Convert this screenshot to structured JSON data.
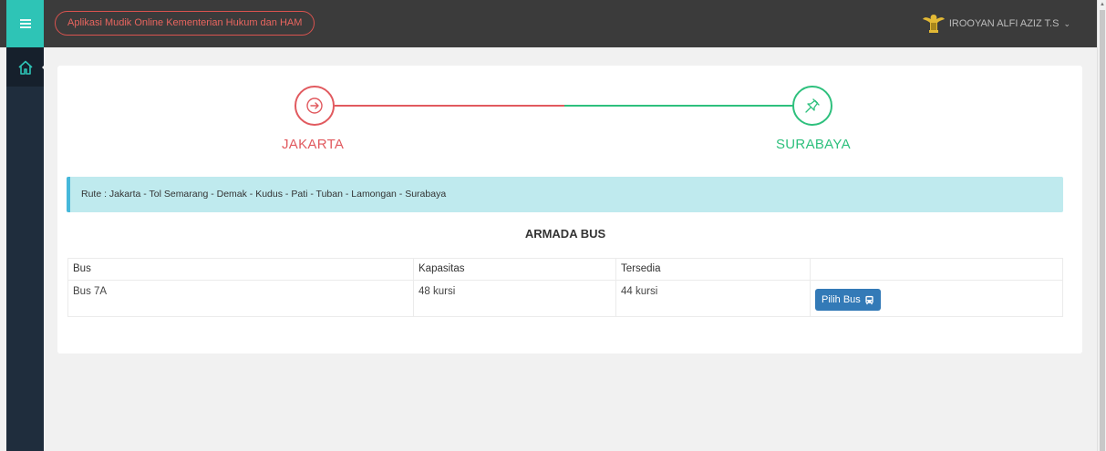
{
  "header": {
    "app_title": "Aplikasi Mudik Online Kementerian Hukum dan HAM",
    "user_name": "IROOYAN ALFI AZIZ T.S",
    "user_chevron": "⌄",
    "menu_icon": "hamburger-icon",
    "emblem_icon": "garuda-emblem-icon"
  },
  "sidebar": {
    "items": [
      {
        "icon": "home-icon",
        "label": ""
      }
    ]
  },
  "route": {
    "origin": "JAKARTA",
    "destination": "SURABAYA",
    "origin_color": "#e15a5f",
    "destination_color": "#2ec07d",
    "route_text": "Rute : Jakarta - Tol Semarang - Demak - Kudus - Pati - Tuban - Lamongan - Surabaya"
  },
  "fleet": {
    "title": "ARMADA BUS",
    "columns": [
      "Bus",
      "Kapasitas",
      "Tersedia",
      ""
    ],
    "rows": [
      {
        "bus": "Bus 7A",
        "capacity": "48 kursi",
        "available": "44 kursi",
        "action": "Pilih Bus"
      }
    ]
  },
  "colors": {
    "accent_teal": "#2ec4b6",
    "topbar": "#3b3b3b",
    "sidebar": "#1f2d3d",
    "button_primary": "#337ab7",
    "alert_bg": "#bfeaee"
  }
}
